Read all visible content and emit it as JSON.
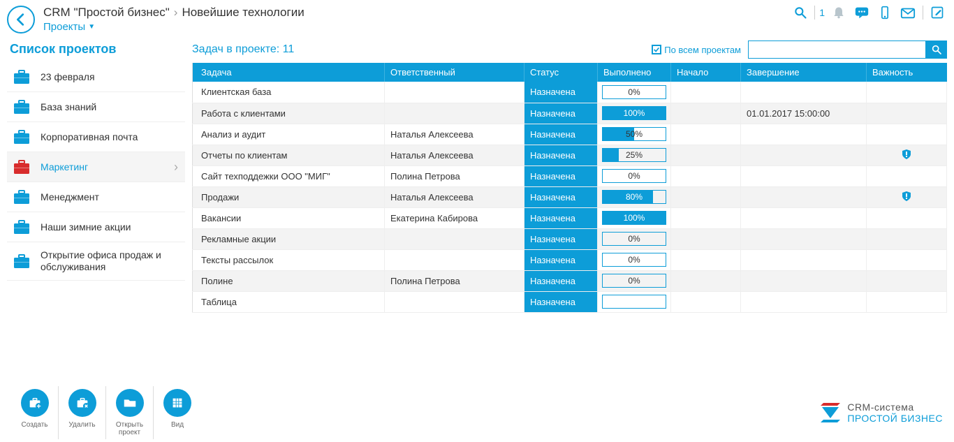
{
  "header": {
    "breadcrumb_app": "CRM \"Простой бизнес\"",
    "breadcrumb_project": "Новейшие технологии",
    "nav_dropdown": "Проекты",
    "notif_count": "1"
  },
  "sidebar": {
    "title": "Список проектов",
    "items": [
      {
        "label": "23 февраля",
        "active": false,
        "red": false
      },
      {
        "label": "База знаний",
        "active": false,
        "red": false
      },
      {
        "label": "Корпоративная почта",
        "active": false,
        "red": false
      },
      {
        "label": "Маркетинг",
        "active": true,
        "red": true
      },
      {
        "label": "Менеджмент",
        "active": false,
        "red": false
      },
      {
        "label": "Наши зимние акции",
        "active": false,
        "red": false
      },
      {
        "label": "Открытие офиса продаж и обслуживания",
        "active": false,
        "red": false
      }
    ]
  },
  "content": {
    "task_count_label": "Задач в проекте: 11",
    "all_projects_label": "По всем проектам",
    "search_placeholder": "",
    "columns": {
      "task": "Задача",
      "responsible": "Ответственный",
      "status": "Статус",
      "done": "Выполнено",
      "start": "Начало",
      "end": "Завершение",
      "importance": "Важность"
    },
    "rows": [
      {
        "task": "Клиентская база",
        "responsible": "",
        "status": "Назначена",
        "done": 0,
        "done_txt": "0%",
        "start": "",
        "end": "",
        "importance": false
      },
      {
        "task": "Работа с клиентами",
        "responsible": "",
        "status": "Назначена",
        "done": 100,
        "done_txt": "100%",
        "start": "",
        "end": "01.01.2017 15:00:00",
        "importance": false
      },
      {
        "task": "Анализ и аудит",
        "responsible": "Наталья Алексеева",
        "status": "Назначена",
        "done": 50,
        "done_txt": "50%",
        "start": "",
        "end": "",
        "importance": false
      },
      {
        "task": "Отчеты по клиентам",
        "responsible": "Наталья Алексеева",
        "status": "Назначена",
        "done": 25,
        "done_txt": "25%",
        "start": "",
        "end": "",
        "importance": true
      },
      {
        "task": "Сайт техподдежки ООО \"МИГ\"",
        "responsible": "Полина Петрова",
        "status": "Назначена",
        "done": 0,
        "done_txt": "0%",
        "start": "",
        "end": "",
        "importance": false
      },
      {
        "task": "Продажи",
        "responsible": "Наталья Алексеева",
        "status": "Назначена",
        "done": 80,
        "done_txt": "80%",
        "start": "",
        "end": "",
        "importance": true
      },
      {
        "task": "Вакансии",
        "responsible": "Екатерина Кабирова",
        "status": "Назначена",
        "done": 100,
        "done_txt": "100%",
        "start": "",
        "end": "",
        "importance": false
      },
      {
        "task": "Рекламные акции",
        "responsible": "",
        "status": "Назначена",
        "done": 0,
        "done_txt": "0%",
        "start": "",
        "end": "",
        "importance": false
      },
      {
        "task": "Тексты рассылок",
        "responsible": "",
        "status": "Назначена",
        "done": 0,
        "done_txt": "0%",
        "start": "",
        "end": "",
        "importance": false
      },
      {
        "task": "Полине",
        "responsible": "Полина Петрова",
        "status": "Назначена",
        "done": 0,
        "done_txt": "0%",
        "start": "",
        "end": "",
        "importance": false
      },
      {
        "task": "Таблица",
        "responsible": "",
        "status": "Назначена",
        "done": null,
        "done_txt": "",
        "start": "",
        "end": "",
        "importance": false
      }
    ]
  },
  "footer": {
    "create": "Создать",
    "delete": "Удалить",
    "open_project": "Открыть проект",
    "view": "Вид",
    "brand_l1": "CRM-система",
    "brand_l2": "ПРОСТОЙ БИЗНЕС"
  }
}
